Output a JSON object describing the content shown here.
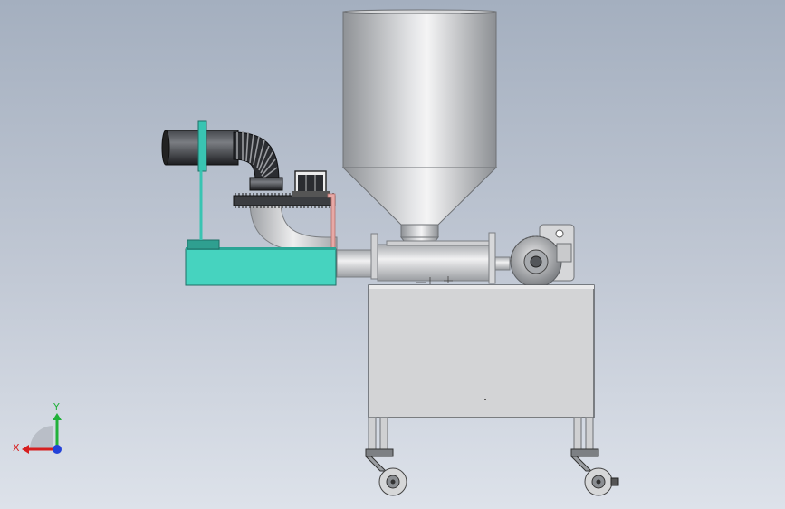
{
  "viewport": {
    "background_top": "#a4afbf",
    "background_bottom": "#dde2ea"
  },
  "model": {
    "parts": [
      "hopper",
      "feed-pipe",
      "motor-base",
      "gear-wheel",
      "stepper-motor",
      "barrel",
      "gearbox",
      "cabinet",
      "caster-wheel-left",
      "caster-wheel-right"
    ],
    "colors": {
      "hopper": "#b9bcc0",
      "motor_base": "#44d3bf",
      "barrel": "#c8cacd",
      "cabinet": "#d2d3d5",
      "pipe_dark": "#2a2c30"
    }
  },
  "triad": {
    "x_label": "X",
    "y_label": "Y",
    "x_color": "#d61f1f",
    "y_color": "#21b13a",
    "z_color": "#2342d8"
  }
}
